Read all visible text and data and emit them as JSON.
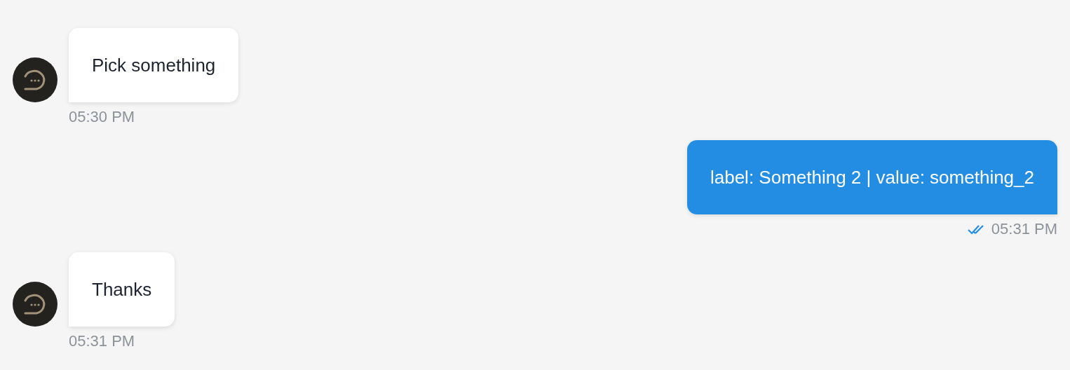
{
  "messages": [
    {
      "kind": "bot",
      "text": "Pick something",
      "time": "05:30 PM"
    },
    {
      "kind": "user",
      "text": "label: Something 2 | value: something_2",
      "time": "05:31 PM",
      "read": true
    },
    {
      "kind": "bot",
      "text": "Thanks",
      "time": "05:31 PM"
    }
  ]
}
